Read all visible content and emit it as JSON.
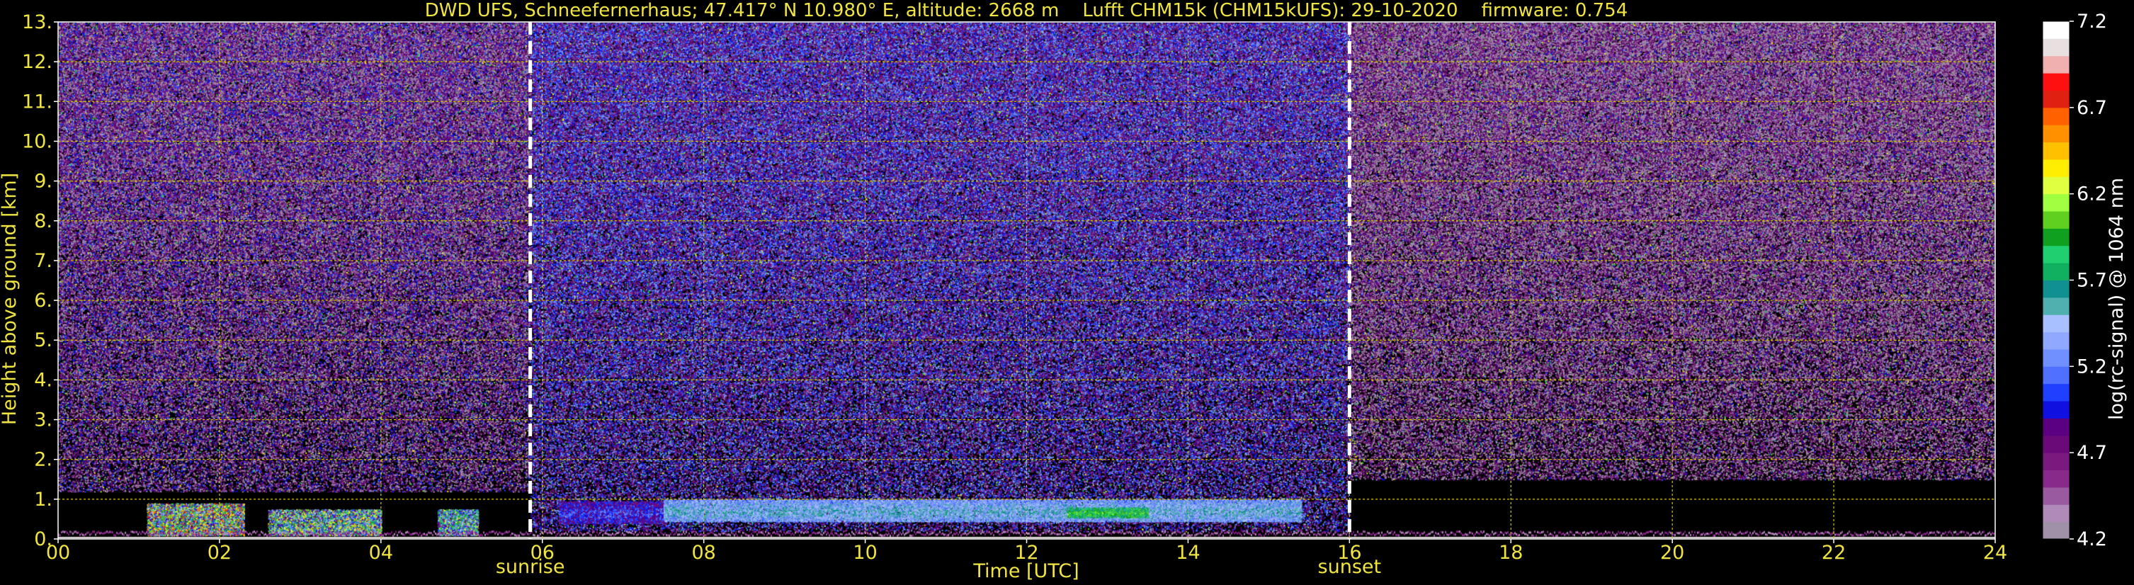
{
  "chart_data": {
    "type": "heatmap",
    "title": "DWD UFS, Schneefernerhaus; 47.417° N 10.980° E, altitude: 2668 m    Lufft CHM15k (CHM15kUFS): 29-10-2020    firmware: 0.754",
    "xlabel": "Time [UTC]",
    "ylabel": "Height above ground [km]",
    "xlim": [
      0,
      24
    ],
    "ylim": [
      0,
      13
    ],
    "x_ticks": [
      "00",
      "02",
      "04",
      "06",
      "08",
      "10",
      "12",
      "14",
      "16",
      "18",
      "20",
      "22",
      "24"
    ],
    "x_tick_values": [
      0,
      2,
      4,
      6,
      8,
      10,
      12,
      14,
      16,
      18,
      20,
      22,
      24
    ],
    "y_ticks": [
      "0.",
      "1.",
      "2.",
      "3.",
      "4.",
      "5.",
      "6.",
      "7.",
      "8.",
      "9.",
      "10.",
      "11.",
      "12.",
      "13."
    ],
    "y_tick_values": [
      0,
      1,
      2,
      3,
      4,
      5,
      6,
      7,
      8,
      9,
      10,
      11,
      12,
      13
    ],
    "grid": true,
    "markers": [
      {
        "label": "sunrise",
        "x": 5.85
      },
      {
        "label": "sunset",
        "x": 16.0
      }
    ],
    "colorbar": {
      "label": "log(rc-signal) @ 1064 nm",
      "range": [
        4.2,
        7.2
      ],
      "tick_labels": [
        "7.2",
        "6.7",
        "6.2",
        "5.7",
        "5.2",
        "4.7",
        "4.2"
      ],
      "tick_values": [
        7.2,
        6.7,
        6.2,
        5.7,
        5.2,
        4.7,
        4.2
      ],
      "colors": [
        "#a090a8",
        "#b08ab8",
        "#9a5aa0",
        "#882a8a",
        "#7a1a7e",
        "#6a0a78",
        "#5a0080",
        "#1010e0",
        "#2040ff",
        "#5070ff",
        "#7090ff",
        "#90a8ff",
        "#a8c0ff",
        "#50b0b0",
        "#109090",
        "#10b060",
        "#20d070",
        "#10a020",
        "#60d020",
        "#a0ff40",
        "#e0ff40",
        "#ffee00",
        "#ffc000",
        "#ff9000",
        "#ff6000",
        "#e02010",
        "#ff1010",
        "#f0b0b0",
        "#e8e0e0",
        "#ffffff"
      ]
    },
    "features": [
      {
        "kind": "noise",
        "x_range": [
          0,
          5.85
        ],
        "y_range": [
          1.2,
          13
        ],
        "intensity": 4.6
      },
      {
        "kind": "noise",
        "x_range": [
          5.85,
          16.0
        ],
        "y_range": [
          0.2,
          13
        ],
        "intensity": 4.9
      },
      {
        "kind": "noise",
        "x_range": [
          16.0,
          24
        ],
        "y_range": [
          1.5,
          13
        ],
        "intensity": 4.5
      },
      {
        "kind": "cloud_layer",
        "x_range": [
          6.2,
          7.5
        ],
        "y_range": [
          0.4,
          0.95
        ],
        "intensity": 4.8
      },
      {
        "kind": "cloud_layer",
        "x_range": [
          7.5,
          15.4
        ],
        "y_range": [
          0.45,
          1.0
        ],
        "intensity": 5.25
      },
      {
        "kind": "cloud_core",
        "x_range": [
          12.5,
          13.5
        ],
        "y_range": [
          0.55,
          0.8
        ],
        "intensity": 5.7
      },
      {
        "kind": "surface_cloud",
        "x_range": [
          1.1,
          2.3
        ],
        "y_range": [
          0.1,
          0.9
        ],
        "intensity": 6.3
      },
      {
        "kind": "surface_cloud",
        "x_range": [
          2.6,
          4.0
        ],
        "y_range": [
          0.1,
          0.75
        ],
        "intensity": 6.0
      },
      {
        "kind": "surface_cloud",
        "x_range": [
          4.7,
          5.2
        ],
        "y_range": [
          0.1,
          0.75
        ],
        "intensity": 5.8
      }
    ]
  }
}
